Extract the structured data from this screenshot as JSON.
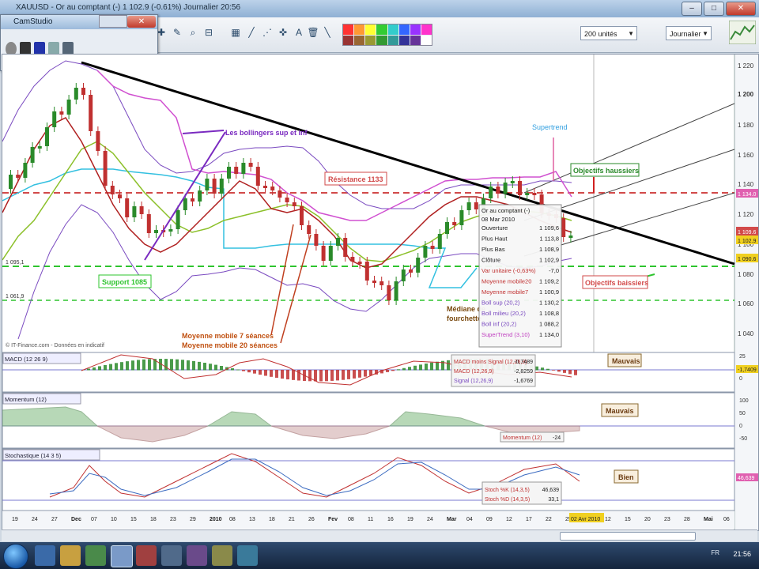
{
  "window": {
    "title": "XAUUSD - Or au comptant (-)   1 102.9 (-0.61%)   Journalier  20:56"
  },
  "toolbar": {
    "period_select": "200 unités",
    "timeframe_select": "Journalier"
  },
  "camstudio": {
    "title": "CamStudio"
  },
  "colors": {
    "up": "#2a8a2a",
    "down": "#c03030",
    "resistance": "#d24a4a",
    "support": "#2ec42e",
    "bollinger": "#7a4ac0",
    "ma7": "#b02020",
    "ma20": "#8cc02a",
    "supertrend": "#33c0e0",
    "trend": "#000000"
  },
  "price_axis": {
    "ticks": [
      "1 220",
      "1 200",
      "1 180",
      "1 160",
      "1 140",
      "1 120",
      "1 100",
      "1 080",
      "1 060",
      "1 040"
    ]
  },
  "price_tags": {
    "upper": "1 134.0",
    "mid1": "1 109.6",
    "mid2": "1 102.9",
    "support": "1 090.6"
  },
  "annotations": {
    "bollinger": "Les bollingers sup et inf",
    "resistance": "Résistance 1133",
    "support": "Support 1085",
    "supertrend": "Supertrend",
    "objectifs_haussiers": "Objectifs haussiers",
    "objectifs_baissiers": "Objectifs baissiers",
    "ma7": "Moyenne mobile 7 séances",
    "ma20": "Moyenne mobile 20 séances",
    "mediane": "Médiane de",
    "fouchette": "fourchette",
    "copyright": "© IT-Finance.com - Données en indicatif",
    "level_left_1": "1 095,1",
    "level_left_2": "1 061,9"
  },
  "tooltip": {
    "title": "Or au comptant (-)",
    "date": "08 Mar 2010",
    "rows": [
      {
        "label": "Ouverture",
        "value": "1 109,6",
        "color": "#202020"
      },
      {
        "label": "Plus Haut",
        "value": "1 113,8",
        "color": "#202020"
      },
      {
        "label": "Plus Bas",
        "value": "1 108,9",
        "color": "#202020"
      },
      {
        "label": "Clôture",
        "value": "1 102,9",
        "color": "#202020"
      },
      {
        "label": "Var unitaire (-0,63%)",
        "value": "-7,0",
        "color": "#c03030"
      },
      {
        "label": "Moyenne mobile20",
        "value": "1 109,2",
        "color": "#c03030"
      },
      {
        "label": "Moyenne mobile7",
        "value": "1 100,9",
        "color": "#c03030"
      },
      {
        "label": "Boll sup (20,2)",
        "value": "1 130,2",
        "color": "#7a4ac0"
      },
      {
        "label": "Boll milieu (20,2)",
        "value": "1 108,8",
        "color": "#7a4ac0"
      },
      {
        "label": "Boll inf (20,2)",
        "value": "1 088,2",
        "color": "#7a4ac0"
      },
      {
        "label": "SuperTrend (3,10)",
        "value": "1 134,0",
        "color": "#c040c0"
      }
    ]
  },
  "panels": {
    "macd": {
      "label": "MACD (12 26 9)",
      "verdict": "Mauvais",
      "rows": [
        {
          "label": "MACD moins Signal (12,26,9)",
          "value": "-0,7489"
        },
        {
          "label": "MACD (12,26,9)",
          "value": "-2,8259"
        },
        {
          "label": "Signal (12,26,9)",
          "value": "-1,6769"
        }
      ],
      "tag": "-1,7409",
      "axis": [
        "25",
        "0"
      ]
    },
    "momentum": {
      "label": "Momentum (12)",
      "verdict": "Mauvais",
      "row": {
        "label": "Momentum (12)",
        "value": "-24"
      },
      "axis": [
        "100",
        "50",
        "0",
        "-50"
      ]
    },
    "stochastique": {
      "label": "Stochastique (14 3 5)",
      "verdict": "Bien",
      "rows": [
        {
          "label": "Stoch %K (14,3,5)",
          "value": "46,639"
        },
        {
          "label": "Stoch %D (14,3,5)",
          "value": "33,1"
        }
      ],
      "tag": "46,639"
    }
  },
  "date_axis": {
    "labels": [
      "19",
      "24",
      "27",
      "Dec",
      "07",
      "10",
      "15",
      "18",
      "23",
      "29",
      "2010",
      "08",
      "13",
      "18",
      "21",
      "26",
      "Fev",
      "08",
      "11",
      "16",
      "19",
      "24",
      "Mar",
      "04",
      "09",
      "12",
      "17",
      "22",
      "25",
      "02 Avr 2010",
      "12",
      "15",
      "20",
      "23",
      "28",
      "Mai",
      "06"
    ],
    "highlight": "02 Avr 2010"
  },
  "taskbar": {
    "clock": "21:56",
    "tray": "FR"
  }
}
